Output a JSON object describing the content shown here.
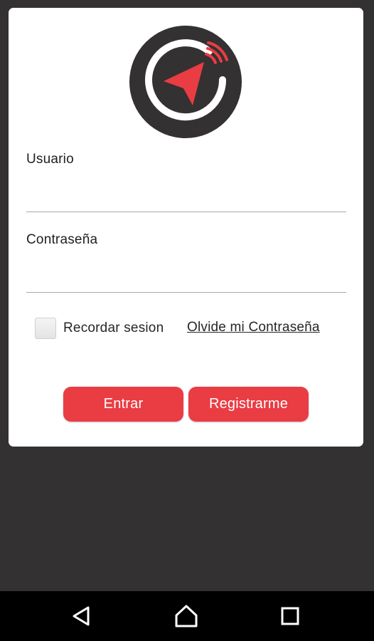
{
  "theme": {
    "accent": "#ea3c43",
    "background": "#333132",
    "card": "#ffffff",
    "logo_circle": "#333132"
  },
  "logo": {
    "icon": "navigation-arrow-signal-logo"
  },
  "form": {
    "username_label": "Usuario",
    "username_value": "",
    "password_label": "Contraseña",
    "password_value": "",
    "remember_label": "Recordar sesion",
    "remember_checked": false,
    "forgot_link": "Olvide mi Contraseña"
  },
  "buttons": {
    "login_label": "Entrar",
    "register_label": "Registrarme"
  },
  "navbar": {
    "back_icon": "back-triangle-icon",
    "home_icon": "home-icon",
    "recents_icon": "recents-square-icon"
  }
}
